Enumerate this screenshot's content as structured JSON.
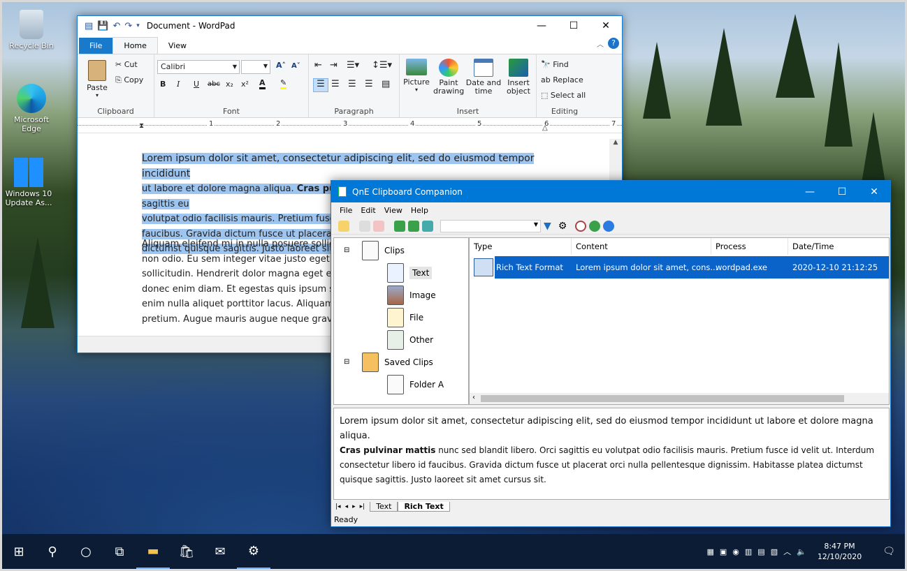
{
  "desktop": {
    "icons": [
      {
        "label": "Recycle Bin",
        "icon": "recycle-bin-icon"
      },
      {
        "label": "Microsoft Edge",
        "icon": "edge-icon"
      },
      {
        "label": "Windows 10 Update As...",
        "icon": "windows-update-icon"
      }
    ]
  },
  "wordpad": {
    "title": "Document - WordPad",
    "tabs": [
      "File",
      "Home",
      "View"
    ],
    "clipboard": {
      "paste": "Paste",
      "cut": "Cut",
      "copy": "Copy",
      "label": "Clipboard"
    },
    "font": {
      "name": "Calibri",
      "size": "",
      "label": "Font"
    },
    "paragraph": {
      "label": "Paragraph"
    },
    "insert": {
      "picture": "Picture",
      "paint": "Paint drawing",
      "datetime": "Date and time",
      "object": "Insert object",
      "label": "Insert"
    },
    "editing": {
      "find": "Find",
      "replace": "Replace",
      "select_all": "Select all",
      "label": "Editing"
    },
    "ruler": [
      "1",
      "2",
      "3",
      "4",
      "5",
      "6",
      "7"
    ],
    "doc": {
      "p1a": "Lorem ipsum dolor sit amet, consectetur adipiscing elit, sed do eiusmod tempor incididunt",
      "p1b_pre": "ut labore et dolore magna aliqua. ",
      "p1b_bold": "Cras pulvinar mattis",
      "p1b_post": " nunc sed blandit libero. Orci sagittis eu",
      "p1c": "volutpat odio facilisis mauris. Pretium fusce",
      "p1d": "faucibus. Gravida dictum fusce ut placerat or",
      "p1e": "dictumst quisque sagittis. Justo laoreet sit a",
      "p2a": "Aliquam eleifend mi in nulla posuere sollici",
      "p2b": "non odio. Eu sem integer vitae justo eget ma",
      "p2c": "sollicitudin. Hendrerit dolor magna eget est",
      "p2d": "donec enim diam. Et egestas quis ipsum sus",
      "p2e": "enim nulla aliquet porttitor lacus. Aliquam f",
      "p2f": "pretium. Augue mauris augue neque gravida"
    }
  },
  "qne": {
    "title": "QnE Clipboard Companion",
    "menu": [
      "File",
      "Edit",
      "View",
      "Help"
    ],
    "tree": {
      "clips": "Clips",
      "text": "Text",
      "image": "Image",
      "file": "File",
      "other": "Other",
      "saved": "Saved Clips",
      "folder": "Folder A"
    },
    "columns": [
      "Type",
      "Content",
      "Process",
      "Date/Time"
    ],
    "rows": [
      {
        "type": "Rich Text Format",
        "content": "Lorem ipsum dolor sit amet, cons...",
        "process": "wordpad.exe",
        "datetime": "2020-12-10 21:12:25"
      }
    ],
    "preview": {
      "line1": "Lorem ipsum dolor sit amet, consectetur adipiscing elit, sed do eiusmod tempor incididunt ut labore et dolore magna aliqua.",
      "bold": "Cras pulvinar mattis",
      "line2": " nunc sed blandit libero. Orci sagittis eu volutpat odio facilisis mauris. Pretium fusce id velit ut. Interdum",
      "line3": "consectetur libero id faucibus. Gravida dictum fusce ut placerat orci nulla pellentesque dignissim. Habitasse platea dictumst",
      "line4": "quisque sagittis. Justo laoreet sit amet cursus sit."
    },
    "tabs": [
      "Text",
      "Rich Text"
    ],
    "status": "Ready"
  },
  "taskbar": {
    "time": "8:47 PM",
    "date": "12/10/2020"
  }
}
